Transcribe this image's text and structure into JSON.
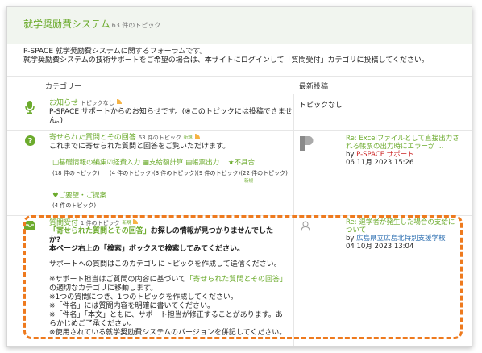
{
  "forum": {
    "title": "就学奨励費システム",
    "topic_count": "63 件のトピック",
    "description_line1": "P-SPACE 就学奨励費システムに関するフォーラムです。",
    "description_line2": "就学奨励費システムの技術サポートをご希望の場合は、本サイトにログインして「質問受付」カテゴリに投稿してください。"
  },
  "columns": {
    "category": "カテゴリー",
    "latest": "最新投稿"
  },
  "categories": [
    {
      "name": "お知らせ",
      "topics": "トピックなし",
      "desc_line1": "P-SPACE サポートからのお知らせです。(※このトピックには投稿できませ",
      "desc_line2": "ん。)",
      "latest_none": "トピックなし"
    },
    {
      "name": "寄せられた質問とその回答",
      "topics": "63 件のトピック",
      "new_label": "新規",
      "desc": "これまでに寄せられた質問と回答をご覧いただけます。",
      "subcategories": [
        {
          "icon": "□",
          "label": "基礎情報の編集",
          "count": "(18 件のトピック)"
        },
        {
          "icon": "☑",
          "label": "経費入力",
          "count": "(4 件のトピック)"
        },
        {
          "icon": "▦",
          "label": "支給額計算",
          "count": "(3 件のトピック)"
        },
        {
          "icon": "▤",
          "label": "帳票出力",
          "count": "(9 件のトピック)"
        },
        {
          "icon": "★",
          "label": "不具合",
          "count": "(22 件のトピック)",
          "new": "新規"
        }
      ],
      "subcategory_row2": {
        "icon": "♥",
        "label": "ご要望・ご提案",
        "count": "(4 件のトピック)"
      },
      "latest": {
        "title_line1": "Re: Excelファイルとして直接出力さ",
        "title_line2": "れる帳票の出力時にエラーが ...",
        "by": "by",
        "author": "P-SPACE サポート",
        "date": "06 11月 2023 15:26"
      }
    },
    {
      "name": "質問受付",
      "topics": "1 件のトピック",
      "new_label": "新規",
      "desc_lines": [
        "お探しの情報が見つかりませんでした",
        "か?",
        "本ページ右上の「検索」ボックスで検索してみてください。",
        "",
        "サポートへの質問はこのカテゴリにトピックを作成して送信ください。",
        "",
        "※サポート担当はご質問の内容に基づいて",
        "の適切なカテゴリに移動します。",
        "※1つの質問につき、1つのトピックを作成してください。",
        "※「件名」には質問内容を明確に書いてください。",
        "※「件名」「本文」ともに、サポート担当が修正することがあります。あ",
        "らかじめご了承ください。",
        "※使用されている就学奨励費システムのバージョンを併記してください。"
      ],
      "inline_link": "「寄せられた質問とその回答」",
      "latest": {
        "title_line1": "Re: 退学者が発生した場合の支給に",
        "title_line2": "ついて",
        "by": "by",
        "author": "広島県立広島北特別支援学校",
        "date": "04 10月 2023 13:04"
      }
    }
  ],
  "colors": {
    "accent": "#6cab2d",
    "highlight": "#ee7a1e",
    "author_red": "#cc2222",
    "author_blue": "#2a6db0"
  }
}
